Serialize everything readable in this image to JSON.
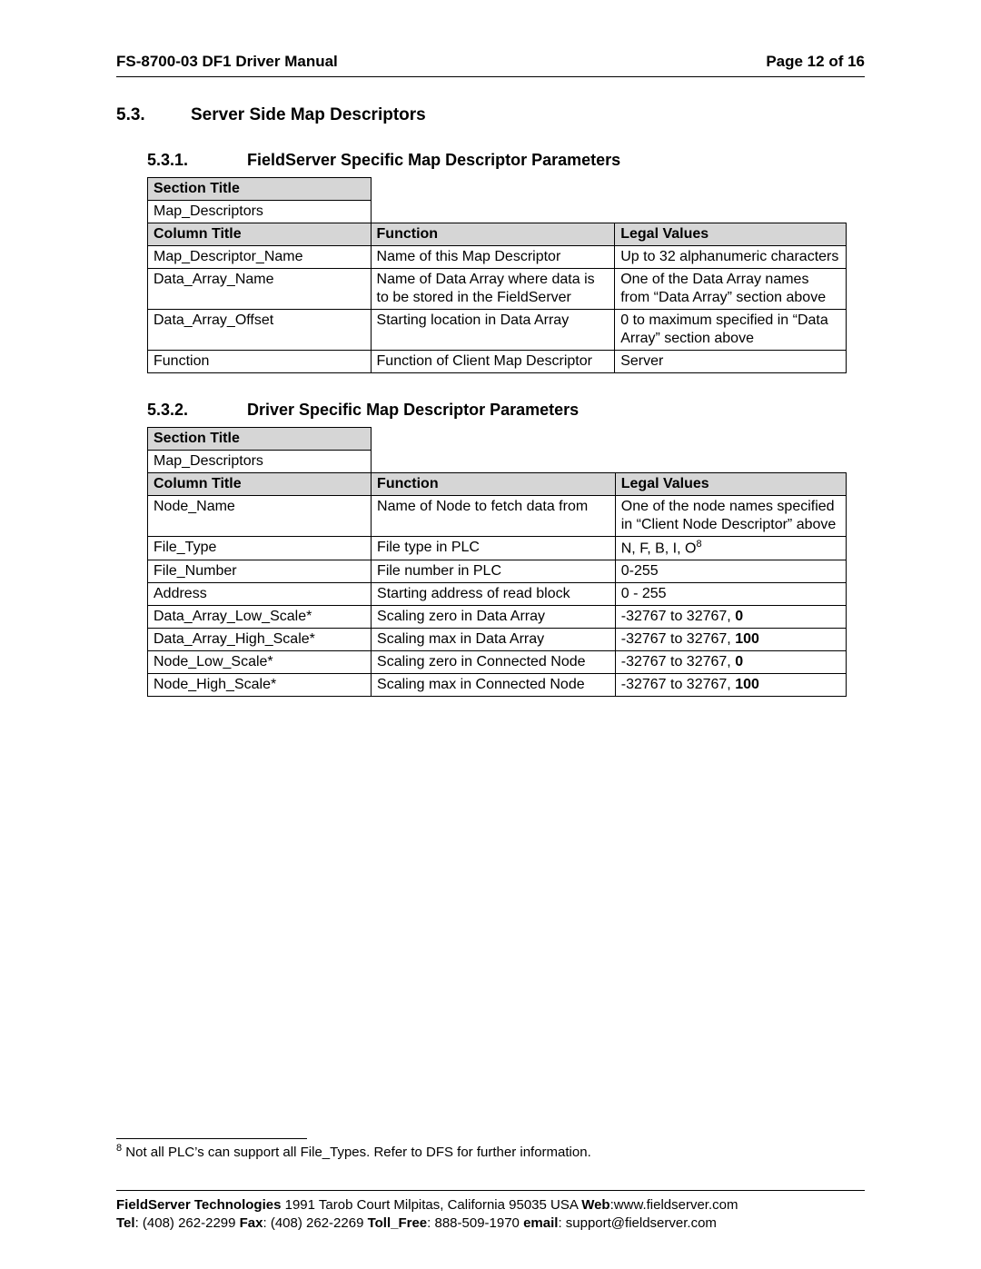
{
  "header": {
    "doc_id": "FS-8700-03 DF1 Driver Manual",
    "page_label": "Page 12 of 16"
  },
  "section": {
    "num": "5.3.",
    "title": "Server Side Map Descriptors"
  },
  "sub1": {
    "num": "5.3.1.",
    "title": "FieldServer Specific Map Descriptor Parameters",
    "section_title_label": "Section Title",
    "section_title_value": "Map_Descriptors",
    "col_title_label": "Column Title",
    "col_function_label": "Function",
    "col_legal_label": "Legal Values",
    "rows": [
      {
        "c": "Map_Descriptor_Name",
        "f": "Name of this Map Descriptor",
        "l": "Up to 32 alphanumeric characters"
      },
      {
        "c": "Data_Array_Name",
        "f": "Name of Data Array where data is to be stored in the FieldServer",
        "l": "One of the Data Array names from “Data Array” section above"
      },
      {
        "c": "Data_Array_Offset",
        "f": "Starting location in Data Array",
        "l": "0 to maximum specified in “Data Array” section above"
      },
      {
        "c": "Function",
        "f": "Function of Client Map Descriptor",
        "l": "Server"
      }
    ]
  },
  "sub2": {
    "num": "5.3.2.",
    "title": "Driver Specific Map Descriptor Parameters",
    "section_title_label": "Section Title",
    "section_title_value": "Map_Descriptors",
    "col_title_label": "Column Title",
    "col_function_label": "Function",
    "col_legal_label": "Legal Values",
    "rows": [
      {
        "c": "Node_Name",
        "f": "Name of Node to fetch data from",
        "l": "One of the node names specified in “Client Node Descriptor” above"
      },
      {
        "c": "File_Type",
        "f": "File type in PLC",
        "l": "N, F, B, I, O",
        "sup": "8"
      },
      {
        "c": "File_Number",
        "f": "File number in PLC",
        "l": "0-255"
      },
      {
        "c": "Address",
        "f": "Starting address of read block",
        "l": "0 - 255"
      },
      {
        "c": "Data_Array_Low_Scale*",
        "f": "Scaling zero in Data Array",
        "l_pre": "-32767 to 32767,  ",
        "l_bold": "0"
      },
      {
        "c": "Data_Array_High_Scale*",
        "f": "Scaling max in Data Array",
        "l_pre": "-32767 to 32767,  ",
        "l_bold": "100"
      },
      {
        "c": "Node_Low_Scale*",
        "f": "Scaling zero in Connected Node",
        "l_pre": "-32767 to 32767,  ",
        "l_bold": "0"
      },
      {
        "c": "Node_High_Scale*",
        "f": "Scaling max in Connected Node",
        "l_pre": "-32767 to 32767,  ",
        "l_bold": "100"
      }
    ]
  },
  "footnote": {
    "marker": "8",
    "text": " Not all PLC’s can support all File_Types.  Refer to DFS for further information."
  },
  "footer": {
    "company_bold": "FieldServer Technologies",
    "address": " 1991 Tarob Court Milpitas, California 95035 USA  ",
    "web_label": "Web",
    "web_value": ":www.fieldserver.com",
    "tel_label": "Tel",
    "tel_value": ": (408) 262-2299   ",
    "fax_label": "Fax",
    "fax_value": ": (408) 262-2269   ",
    "toll_label": "Toll_Free",
    "toll_value": ": 888-509-1970   ",
    "email_label": "email",
    "email_value": ": support@fieldserver.com"
  }
}
